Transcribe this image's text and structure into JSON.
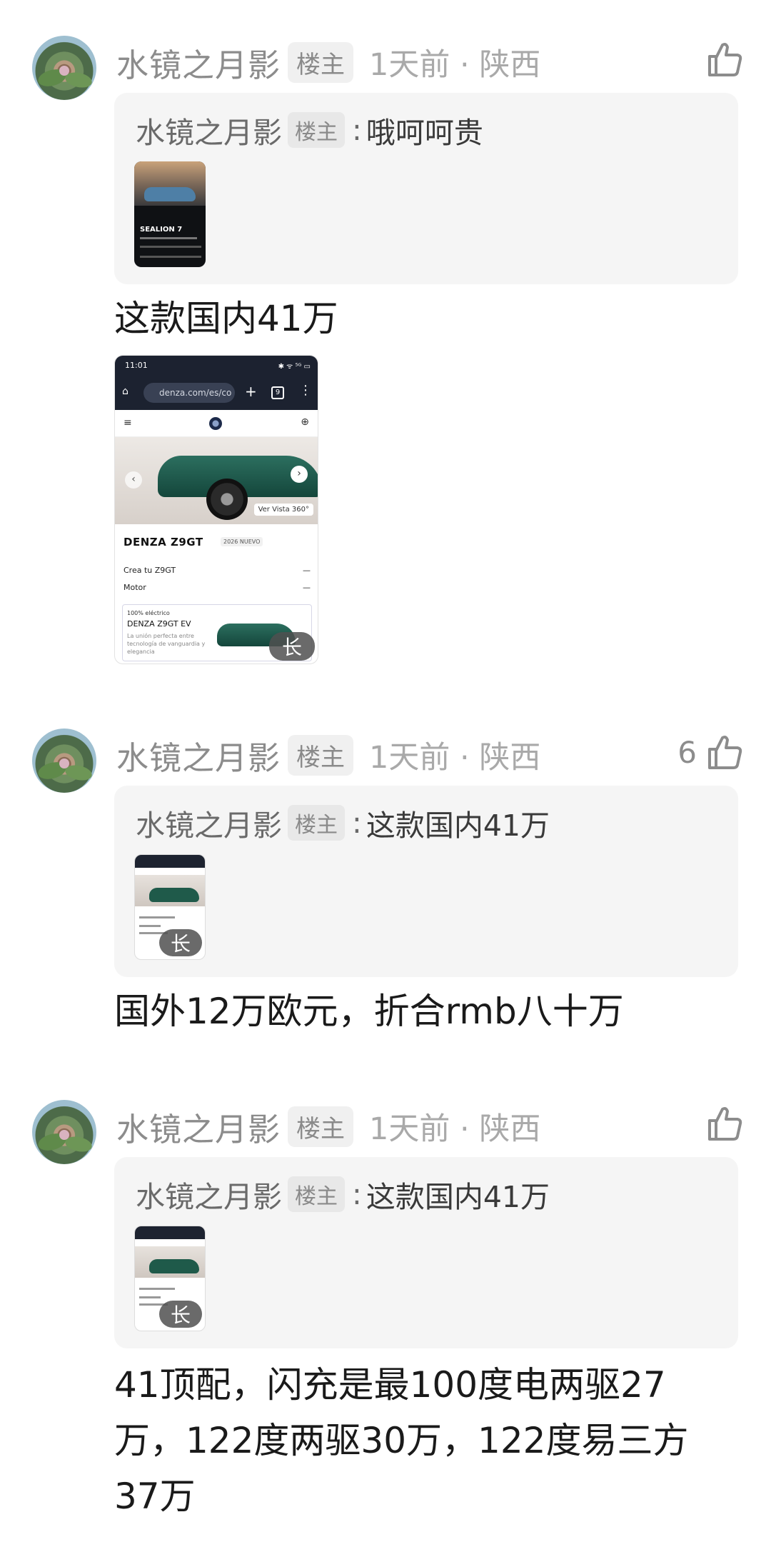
{
  "comments": [
    {
      "username": "水镜之月影",
      "badge": "楼主",
      "time_loc": "1天前 · 陕西",
      "likes": "",
      "quote": {
        "username": "水镜之月影",
        "badge": "楼主",
        "separator": ":",
        "text": "哦呵呵贵",
        "thumb_title": "SEALION 7"
      },
      "text": "这款国内41万",
      "screenshot": {
        "time": "11:01",
        "status_icons": "✱ ᯤ ⁵ᴳ ▭",
        "url": "denza.com/es/co",
        "tab_count": "9",
        "hero_button": "Ver Vista 360°",
        "model_name": "DENZA Z9GT",
        "model_badge": "2026 NUEVO",
        "menu_row_1": "Crea tu Z9GT",
        "menu_row_2": "Motor",
        "row_dash": "—",
        "card_tag": "100% eléctrico",
        "card_title": "DENZA Z9GT EV",
        "card_desc": "La unión perfecta entre tecnología de vanguardia y elegancia",
        "long_label": "长"
      }
    },
    {
      "username": "水镜之月影",
      "badge": "楼主",
      "time_loc": "1天前 · 陕西",
      "likes": "6",
      "quote": {
        "username": "水镜之月影",
        "badge": "楼主",
        "separator": ":",
        "text": "这款国内41万",
        "long_label": "长"
      },
      "text": "国外12万欧元，折合rmb八十万"
    },
    {
      "username": "水镜之月影",
      "badge": "楼主",
      "time_loc": "1天前 · 陕西",
      "likes": "",
      "quote": {
        "username": "水镜之月影",
        "badge": "楼主",
        "separator": ":",
        "text": "这款国内41万",
        "long_label": "长"
      },
      "text_lines": [
        "41顶配，闪充是最100度电两驱27",
        "万，122度两驱30万，122度易三方",
        "37万"
      ]
    }
  ]
}
